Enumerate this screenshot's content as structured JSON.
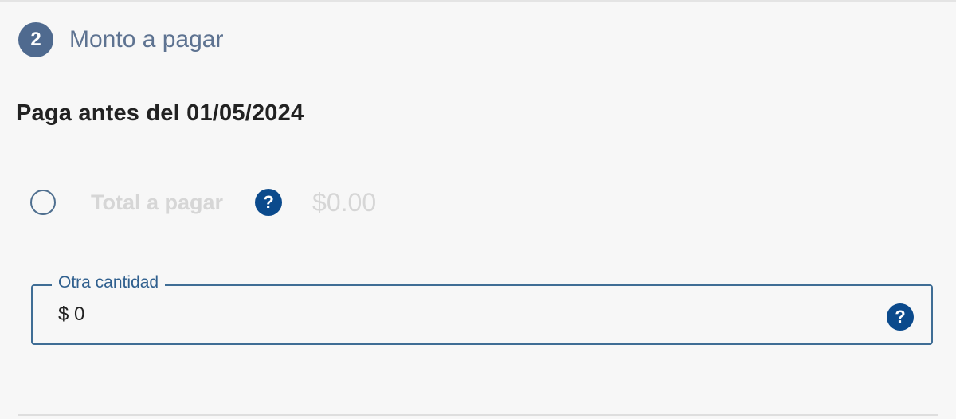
{
  "step": {
    "number": "2",
    "title": "Monto a pagar"
  },
  "due": {
    "label": "Paga antes del 01/05/2024"
  },
  "total_option": {
    "label": "Total a pagar",
    "help_icon": "?",
    "amount": "$0.00",
    "selected": false
  },
  "other_amount": {
    "legend": "Otra cantidad",
    "value": "$ 0",
    "help_icon": "?"
  },
  "colors": {
    "accent": "#0b4a8c",
    "badge": "#4f6a8f",
    "field_border": "#3f6d95",
    "disabled_text": "#d6d6d6"
  }
}
